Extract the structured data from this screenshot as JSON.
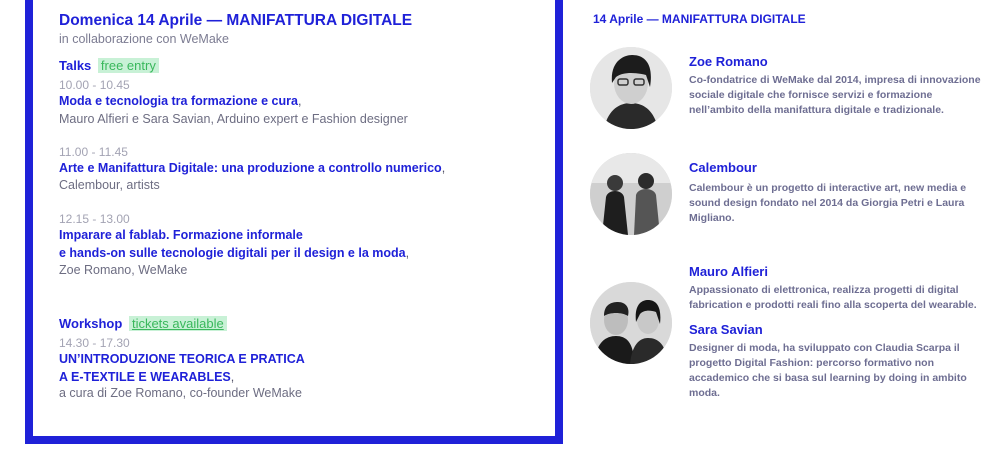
{
  "program": {
    "title": "Domenica 14 Aprile — MANIFATTURA DIGITALE",
    "subtitle": "in collaborazione con WeMake",
    "talks": {
      "label": "Talks",
      "badge": "free entry",
      "items": [
        {
          "time": "10.00 - 10.45",
          "title_lines": [
            "Moda e tecnologia tra formazione e cura"
          ],
          "speakers": "Mauro Alfieri e Sara Savian, Arduino expert e Fashion designer"
        },
        {
          "time": "11.00 - 11.45",
          "title_lines": [
            "Arte e Manifattura Digitale: una produzione a controllo numerico"
          ],
          "speakers": "Calembour, artists"
        },
        {
          "time": "12.15 - 13.00",
          "title_lines": [
            "Imparare al fablab. Formazione informale",
            "e hands-on sulle tecnologie digitali per il design e la moda"
          ],
          "speakers": "Zoe Romano, WeMake"
        }
      ]
    },
    "workshop": {
      "label": "Workshop",
      "badge": "tickets available",
      "time": "14.30 - 17.30",
      "title_lines": [
        "UN’INTRODUZIONE TEORICA E PRATICA",
        "A E-TEXTILE E WEARABLES"
      ],
      "speakers": "a cura di Zoe Romano, co-founder WeMake"
    },
    "comma": ","
  },
  "speakers_panel": {
    "heading": "14 Aprile — MANIFATTURA DIGITALE",
    "people": [
      {
        "name": "Zoe Romano",
        "bio": "Co-fondatrice di WeMake dal 2014, impresa di innovazione sociale digitale che fornisce servizi e formazione nell’ambito della manifattura digitale e tradizionale."
      },
      {
        "name": "Calembour",
        "bio": "Calembour è un progetto di interactive art, new media e sound design fondato nel 2014 da Giorgia Petri e Laura Migliano."
      },
      {
        "name": "Mauro Alfieri",
        "bio": "Appassionato di elettronica, realizza progetti di digital fabrication e prodotti reali fino alla scoperta del wearable."
      },
      {
        "name": "Sara Savian",
        "bio": "Designer di moda, ha sviluppato con Claudia Scarpa il progetto Digital Fashion: percorso formativo non accademico che si basa sul learning by doing in ambito moda."
      }
    ]
  },
  "colors": {
    "accent": "#1f21d8",
    "badge_bg": "#c8f1d6",
    "badge_text": "#3ab85c",
    "muted": "#a3a3b3"
  }
}
